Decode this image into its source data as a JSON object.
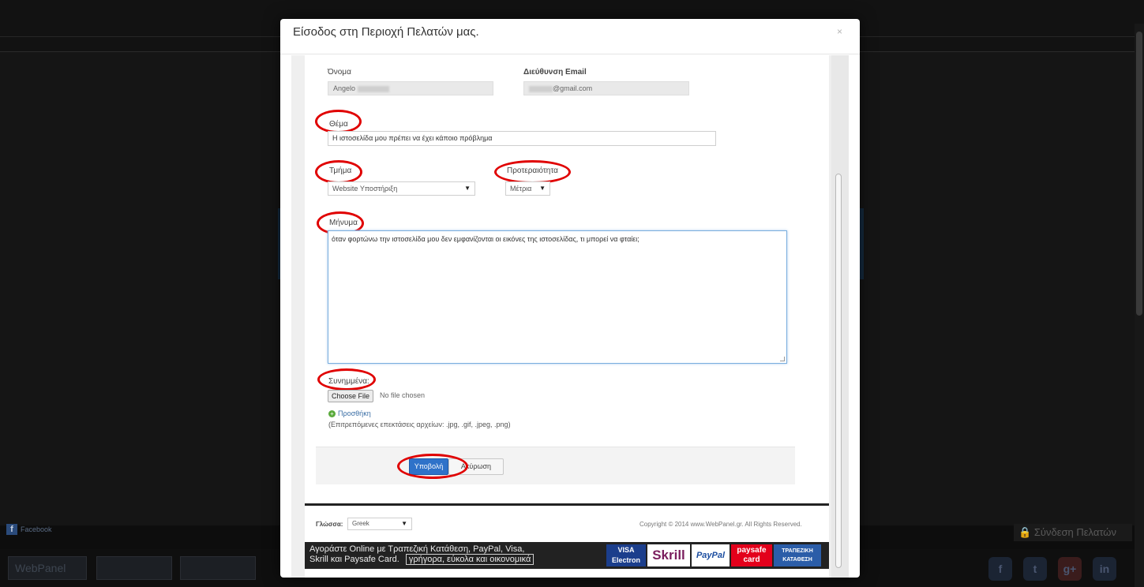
{
  "modal": {
    "title": "Είσοδος στη Περιοχή Πελατών μας.",
    "close": "×"
  },
  "form": {
    "name_label": "Όνομα",
    "name_value": "Angelo",
    "email_label": "Διεύθυνση Email",
    "email_value": "@gmail.com",
    "subject_label": "Θέμα",
    "subject_value": "Η ιστοσελίδα μου πρέπει να έχει κάποιο πρόβλημα",
    "department_label": "Τμήμα",
    "department_value": "Website Υποστήριξη",
    "priority_label": "Προτεραιότητα",
    "priority_value": "Μέτρια",
    "message_label": "Μήνυμα",
    "message_value": "όταν φορτώνω την ιστοσελίδα μου δεν εμφανίζονται οι εικόνες της ιστοσελίδας, τι μπορεί να φταίει;",
    "attachments_label": "Συνημμένα:",
    "file_button": "Choose File",
    "file_status": "No file chosen",
    "add_link": "Προσθήκη",
    "allowed_ext": "(Επιτρεπόμενες επεκτάσεις αρχείων: .jpg, .gif, .jpeg, .png)",
    "submit_label": "Υποβολή",
    "cancel_label": "Ακύρωση"
  },
  "footer": {
    "language_label": "Γλώσσα:",
    "language_value": "Greek",
    "copyright": "Copyright © 2014 www.WebPanel.gr. All Rights Reserved.",
    "pay_line1": "Αγοράστε Online με Τραπεζική Κατάθεση, PayPal, Visa,",
    "pay_line2": "Skrill και Paysafe Card.",
    "pay_box": "γρήγορα, εύκολα και οικονομικά",
    "logos": {
      "visa_top": "VISA",
      "visa_bottom": "Electron",
      "skrill": "Skrill",
      "paypal": "PayPal",
      "paysafe_top": "paysafe",
      "paysafe_bottom": "card",
      "bank_top": "ΤΡΑΠΕΖΙΚΗ",
      "bank_bottom": "ΚΑΤΑΘΕΣΗ"
    }
  },
  "background": {
    "facebook_label": "Facebook",
    "client_login": "Σύνδεση Πελατών",
    "webpanel_logo": "WebPanel",
    "social": [
      "f",
      "t",
      "g+",
      "in"
    ]
  },
  "colors": {
    "annotation_ring": "#e00000",
    "primary_button": "#2f72c9",
    "textarea_focus": "#7aaede"
  }
}
